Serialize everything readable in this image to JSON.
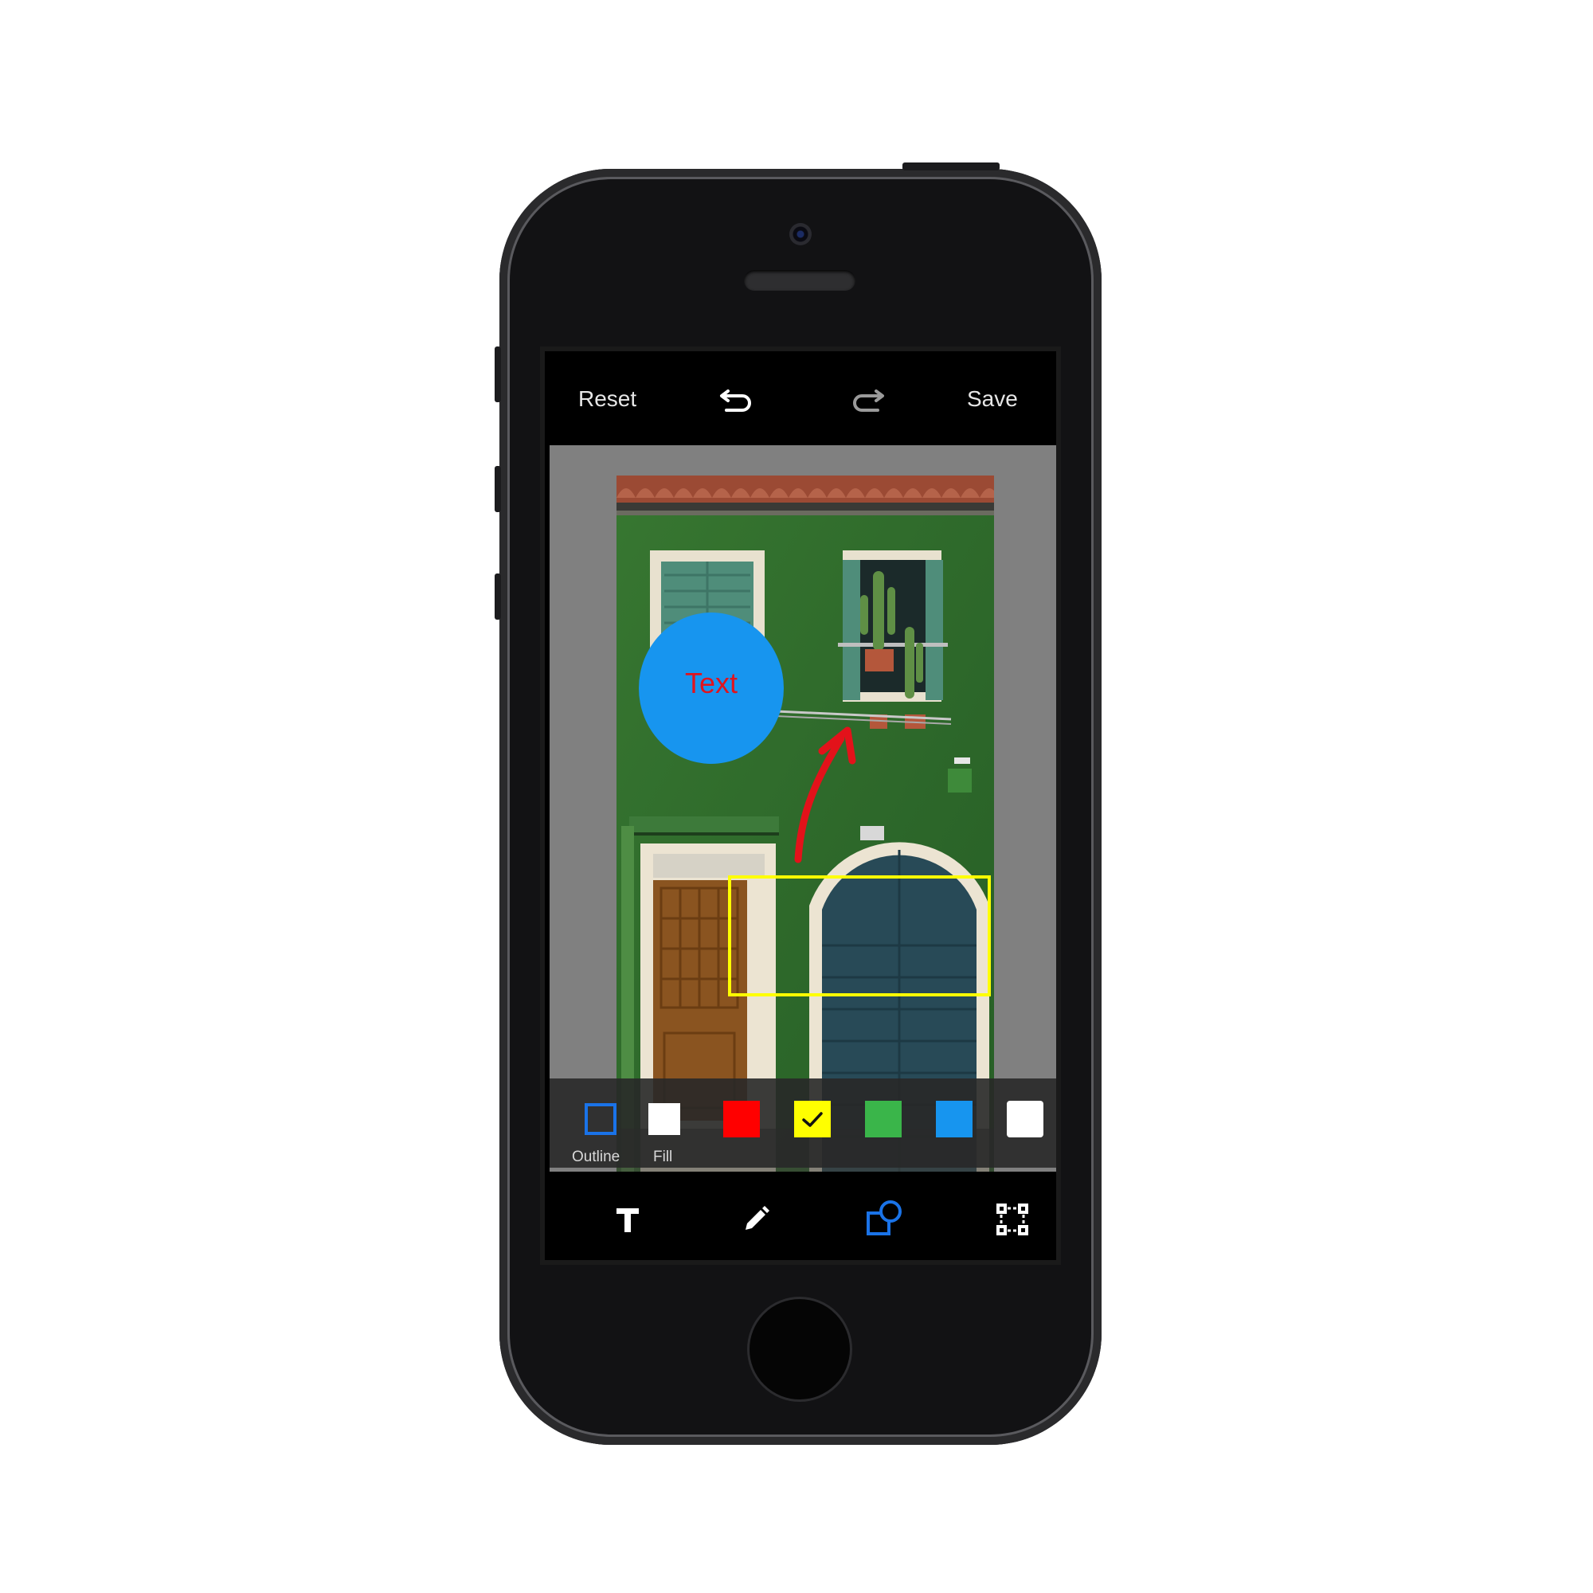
{
  "topbar": {
    "reset_label": "Reset",
    "undo_icon": "undo-icon",
    "redo_icon": "redo-icon",
    "save_label": "Save"
  },
  "canvas": {
    "circle_text": "Text",
    "circle_color": "#1795ef",
    "circle_text_color": "#e0141e",
    "rect_color": "#ffff00",
    "arrow_color": "#e3121a"
  },
  "palette": {
    "outline_label": "Outline",
    "fill_label": "Fill",
    "colors": [
      "#ff0000",
      "#ffff00",
      "#3ab54a",
      "#1795ef",
      "#ffffff"
    ],
    "selected_color": "#ffff00",
    "outline_color": "#1a73e8",
    "fill_color": "#ffffff"
  },
  "toolbar": {
    "tools": [
      "text-tool-icon",
      "pencil-tool-icon",
      "shape-tool-icon",
      "crop-tool-icon"
    ],
    "active_tool": "shape-tool-icon",
    "active_color": "#1a73e8"
  }
}
